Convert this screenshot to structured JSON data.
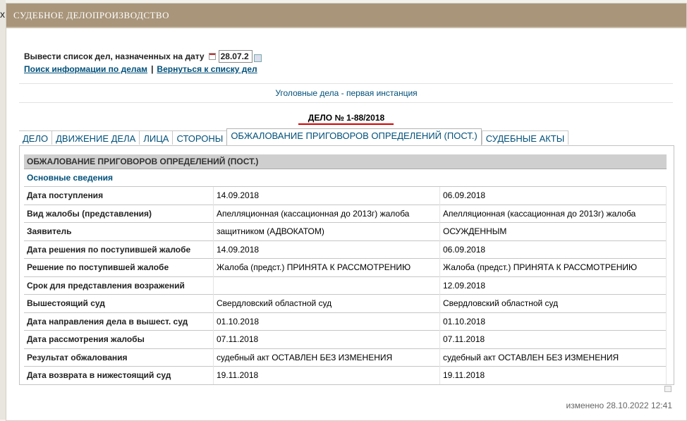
{
  "window": {
    "close_glyph": "x"
  },
  "header": {
    "title": "СУДЕБНОЕ ДЕЛОПРОИЗВОДСТВО"
  },
  "date_filter": {
    "label": "Вывести список дел, назначенных на дату",
    "value": "28.07.2"
  },
  "links": {
    "search": "Поиск информации по делам",
    "separator": "|",
    "back": "Вернуться к списку дел"
  },
  "instance_title": "Уголовные дела - первая инстанция",
  "case_title": "ДЕЛО № 1-88/2018",
  "tabs": [
    {
      "label": "ДЕЛО",
      "active": false
    },
    {
      "label": "ДВИЖЕНИЕ ДЕЛА",
      "active": false
    },
    {
      "label": "ЛИЦА",
      "active": false
    },
    {
      "label": "СТОРОНЫ",
      "active": false
    },
    {
      "label": "ОБЖАЛОВАНИЕ ПРИГОВОРОВ ОПРЕДЕЛЕНИЙ (ПОСТ.)",
      "active": true
    },
    {
      "label": "СУДЕБНЫЕ АКТЫ",
      "active": false
    }
  ],
  "appeal_table": {
    "header": "ОБЖАЛОВАНИЕ ПРИГОВОРОВ ОПРЕДЕЛЕНИЙ (ПОСТ.)",
    "section": "Основные сведения",
    "rows": [
      {
        "label": "Дата поступления",
        "v1": "14.09.2018",
        "v2": "06.09.2018"
      },
      {
        "label": "Вид жалобы (представления)",
        "v1": "Апелляционная (кассационная до 2013г) жалоба",
        "v2": "Апелляционная (кассационная до 2013г) жалоба"
      },
      {
        "label": "Заявитель",
        "v1": "защитником (АДВОКАТОМ)",
        "v2": "ОСУЖДЕННЫМ"
      },
      {
        "label": "Дата решения по поступившей жалобе",
        "v1": "14.09.2018",
        "v2": "06.09.2018"
      },
      {
        "label": "Решение по поступившей жалобе",
        "v1": "Жалоба (предст.) ПРИНЯТА К РАССМОТРЕНИЮ",
        "v2": "Жалоба (предст.) ПРИНЯТА К РАССМОТРЕНИЮ"
      },
      {
        "label": "Срок для представления возражений",
        "v1": "",
        "v2": "12.09.2018"
      },
      {
        "label": "Вышестоящий суд",
        "v1": "Свердловский областной суд",
        "v2": "Свердловский областной суд"
      },
      {
        "label": "Дата направления дела в вышест. суд",
        "v1": "01.10.2018",
        "v2": "01.10.2018"
      },
      {
        "label": "Дата рассмотрения жалобы",
        "v1": "07.11.2018",
        "v2": "07.11.2018"
      },
      {
        "label": "Результат обжалования",
        "v1": "судебный акт ОСТАВЛЕН БЕЗ ИЗМЕНЕНИЯ",
        "v2": "судебный акт ОСТАВЛЕН БЕЗ ИЗМЕНЕНИЯ"
      },
      {
        "label": "Дата возврата в нижестоящий суд",
        "v1": "19.11.2018",
        "v2": "19.11.2018"
      }
    ]
  },
  "footer": {
    "modified": "изменено 28.10.2022 12:41"
  },
  "icons": {
    "calendar_left": "calendar-icon",
    "calendar_right": "calendar-picker-icon",
    "print": "print-icon"
  }
}
